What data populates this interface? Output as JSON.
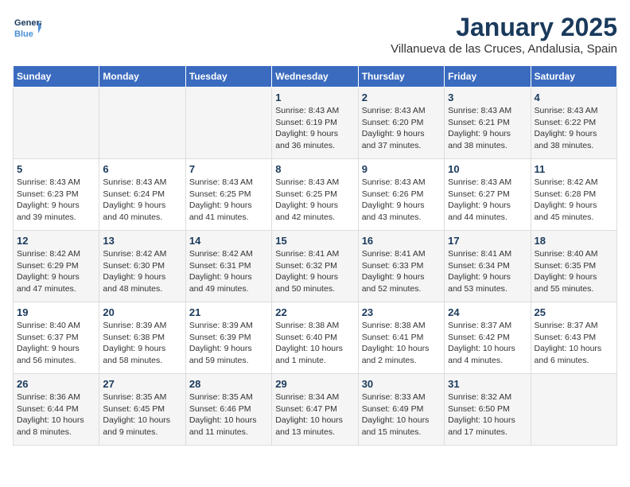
{
  "header": {
    "logo_line1": "General",
    "logo_line2": "Blue",
    "month_title": "January 2025",
    "subtitle": "Villanueva de las Cruces, Andalusia, Spain"
  },
  "days_of_week": [
    "Sunday",
    "Monday",
    "Tuesday",
    "Wednesday",
    "Thursday",
    "Friday",
    "Saturday"
  ],
  "weeks": [
    [
      {
        "day": "",
        "info": ""
      },
      {
        "day": "",
        "info": ""
      },
      {
        "day": "",
        "info": ""
      },
      {
        "day": "1",
        "info": "Sunrise: 8:43 AM\nSunset: 6:19 PM\nDaylight: 9 hours\nand 36 minutes."
      },
      {
        "day": "2",
        "info": "Sunrise: 8:43 AM\nSunset: 6:20 PM\nDaylight: 9 hours\nand 37 minutes."
      },
      {
        "day": "3",
        "info": "Sunrise: 8:43 AM\nSunset: 6:21 PM\nDaylight: 9 hours\nand 38 minutes."
      },
      {
        "day": "4",
        "info": "Sunrise: 8:43 AM\nSunset: 6:22 PM\nDaylight: 9 hours\nand 38 minutes."
      }
    ],
    [
      {
        "day": "5",
        "info": "Sunrise: 8:43 AM\nSunset: 6:23 PM\nDaylight: 9 hours\nand 39 minutes."
      },
      {
        "day": "6",
        "info": "Sunrise: 8:43 AM\nSunset: 6:24 PM\nDaylight: 9 hours\nand 40 minutes."
      },
      {
        "day": "7",
        "info": "Sunrise: 8:43 AM\nSunset: 6:25 PM\nDaylight: 9 hours\nand 41 minutes."
      },
      {
        "day": "8",
        "info": "Sunrise: 8:43 AM\nSunset: 6:25 PM\nDaylight: 9 hours\nand 42 minutes."
      },
      {
        "day": "9",
        "info": "Sunrise: 8:43 AM\nSunset: 6:26 PM\nDaylight: 9 hours\nand 43 minutes."
      },
      {
        "day": "10",
        "info": "Sunrise: 8:43 AM\nSunset: 6:27 PM\nDaylight: 9 hours\nand 44 minutes."
      },
      {
        "day": "11",
        "info": "Sunrise: 8:42 AM\nSunset: 6:28 PM\nDaylight: 9 hours\nand 45 minutes."
      }
    ],
    [
      {
        "day": "12",
        "info": "Sunrise: 8:42 AM\nSunset: 6:29 PM\nDaylight: 9 hours\nand 47 minutes."
      },
      {
        "day": "13",
        "info": "Sunrise: 8:42 AM\nSunset: 6:30 PM\nDaylight: 9 hours\nand 48 minutes."
      },
      {
        "day": "14",
        "info": "Sunrise: 8:42 AM\nSunset: 6:31 PM\nDaylight: 9 hours\nand 49 minutes."
      },
      {
        "day": "15",
        "info": "Sunrise: 8:41 AM\nSunset: 6:32 PM\nDaylight: 9 hours\nand 50 minutes."
      },
      {
        "day": "16",
        "info": "Sunrise: 8:41 AM\nSunset: 6:33 PM\nDaylight: 9 hours\nand 52 minutes."
      },
      {
        "day": "17",
        "info": "Sunrise: 8:41 AM\nSunset: 6:34 PM\nDaylight: 9 hours\nand 53 minutes."
      },
      {
        "day": "18",
        "info": "Sunrise: 8:40 AM\nSunset: 6:35 PM\nDaylight: 9 hours\nand 55 minutes."
      }
    ],
    [
      {
        "day": "19",
        "info": "Sunrise: 8:40 AM\nSunset: 6:37 PM\nDaylight: 9 hours\nand 56 minutes."
      },
      {
        "day": "20",
        "info": "Sunrise: 8:39 AM\nSunset: 6:38 PM\nDaylight: 9 hours\nand 58 minutes."
      },
      {
        "day": "21",
        "info": "Sunrise: 8:39 AM\nSunset: 6:39 PM\nDaylight: 9 hours\nand 59 minutes."
      },
      {
        "day": "22",
        "info": "Sunrise: 8:38 AM\nSunset: 6:40 PM\nDaylight: 10 hours\nand 1 minute."
      },
      {
        "day": "23",
        "info": "Sunrise: 8:38 AM\nSunset: 6:41 PM\nDaylight: 10 hours\nand 2 minutes."
      },
      {
        "day": "24",
        "info": "Sunrise: 8:37 AM\nSunset: 6:42 PM\nDaylight: 10 hours\nand 4 minutes."
      },
      {
        "day": "25",
        "info": "Sunrise: 8:37 AM\nSunset: 6:43 PM\nDaylight: 10 hours\nand 6 minutes."
      }
    ],
    [
      {
        "day": "26",
        "info": "Sunrise: 8:36 AM\nSunset: 6:44 PM\nDaylight: 10 hours\nand 8 minutes."
      },
      {
        "day": "27",
        "info": "Sunrise: 8:35 AM\nSunset: 6:45 PM\nDaylight: 10 hours\nand 9 minutes."
      },
      {
        "day": "28",
        "info": "Sunrise: 8:35 AM\nSunset: 6:46 PM\nDaylight: 10 hours\nand 11 minutes."
      },
      {
        "day": "29",
        "info": "Sunrise: 8:34 AM\nSunset: 6:47 PM\nDaylight: 10 hours\nand 13 minutes."
      },
      {
        "day": "30",
        "info": "Sunrise: 8:33 AM\nSunset: 6:49 PM\nDaylight: 10 hours\nand 15 minutes."
      },
      {
        "day": "31",
        "info": "Sunrise: 8:32 AM\nSunset: 6:50 PM\nDaylight: 10 hours\nand 17 minutes."
      },
      {
        "day": "",
        "info": ""
      }
    ]
  ]
}
